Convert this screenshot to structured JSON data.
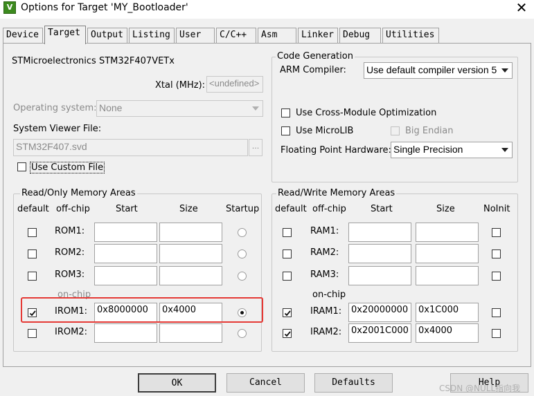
{
  "window": {
    "title": "Options for Target 'MY_Bootloader'",
    "app_icon": "V",
    "close": "✕"
  },
  "tabs": [
    {
      "label": "Device"
    },
    {
      "label": "Target"
    },
    {
      "label": "Output"
    },
    {
      "label": "Listing"
    },
    {
      "label": "User"
    },
    {
      "label": "C/C++"
    },
    {
      "label": "Asm"
    },
    {
      "label": "Linker"
    },
    {
      "label": "Debug"
    },
    {
      "label": "Utilities"
    }
  ],
  "active_tab": "Target",
  "device": {
    "name": "STMicroelectronics STM32F407VETx",
    "xtal_label": "Xtal (MHz):",
    "xtal_value": "<undefined>",
    "os_label": "Operating system:",
    "os_value": "None",
    "svd_label": "System Viewer File:",
    "svd_value": "STM32F407.svd",
    "browse_label": "...",
    "custom_file_label": "Use Custom File"
  },
  "code_generation": {
    "title": "Code Generation",
    "compiler_label": "ARM Compiler:",
    "compiler_value": "Use default compiler version 5",
    "cross_module_label": "Use Cross-Module Optimization",
    "microlib_label": "Use MicroLIB",
    "big_endian_label": "Big Endian",
    "fpu_label": "Floating Point Hardware:",
    "fpu_value": "Single Precision"
  },
  "ro_memory": {
    "title": "Read/Only Memory Areas",
    "headers": {
      "default": "default",
      "offchip": "off-chip",
      "start": "Start",
      "size": "Size",
      "startup": "Startup"
    },
    "onchip_label": "on-chip",
    "rows": [
      {
        "name": "ROM1:",
        "start": "",
        "size": "",
        "default": false,
        "startup": false
      },
      {
        "name": "ROM2:",
        "start": "",
        "size": "",
        "default": false,
        "startup": false
      },
      {
        "name": "ROM3:",
        "start": "",
        "size": "",
        "default": false,
        "startup": false
      },
      {
        "name": "IROM1:",
        "start": "0x8000000",
        "size": "0x4000",
        "default": true,
        "startup": true
      },
      {
        "name": "IROM2:",
        "start": "",
        "size": "",
        "default": false,
        "startup": false
      }
    ]
  },
  "rw_memory": {
    "title": "Read/Write Memory Areas",
    "headers": {
      "default": "default",
      "offchip": "off-chip",
      "start": "Start",
      "size": "Size",
      "noinit": "NoInit"
    },
    "onchip_label": "on-chip",
    "rows": [
      {
        "name": "RAM1:",
        "start": "",
        "size": "",
        "default": false,
        "noinit": false
      },
      {
        "name": "RAM2:",
        "start": "",
        "size": "",
        "default": false,
        "noinit": false
      },
      {
        "name": "RAM3:",
        "start": "",
        "size": "",
        "default": false,
        "noinit": false
      },
      {
        "name": "IRAM1:",
        "start": "0x20000000",
        "size": "0x1C000",
        "default": true,
        "noinit": false
      },
      {
        "name": "IRAM2:",
        "start": "0x2001C000",
        "size": "0x4000",
        "default": true,
        "noinit": false
      }
    ]
  },
  "buttons": {
    "ok": "OK",
    "cancel": "Cancel",
    "defaults": "Defaults",
    "help": "Help"
  },
  "watermark": "CSDN @NULL指向我",
  "colors": {
    "highlight": "#e53935"
  }
}
